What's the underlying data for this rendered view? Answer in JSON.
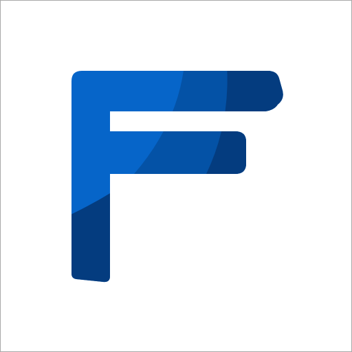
{
  "logo": {
    "name": "letter-f-logo",
    "colors": {
      "primary": "#0665c9",
      "mid": "#0452a6",
      "dark": "#043c7f",
      "border": "#a8a8a8",
      "background": "#ffffff"
    }
  }
}
